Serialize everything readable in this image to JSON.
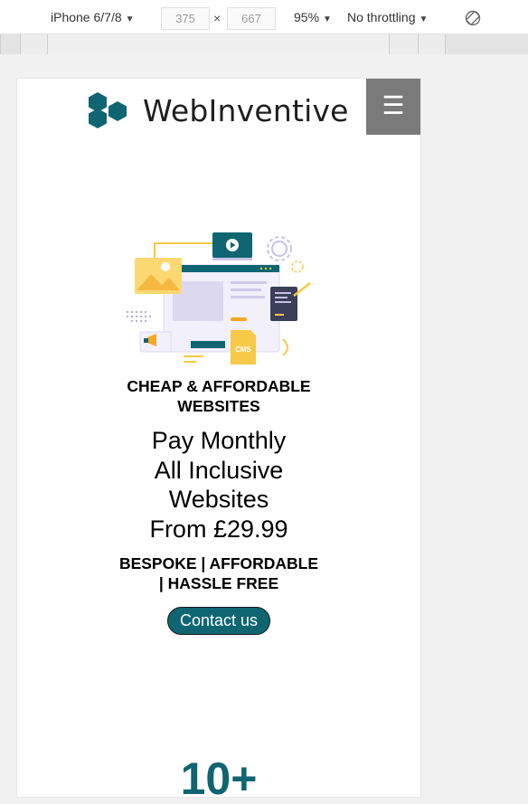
{
  "devtools": {
    "device": "iPhone 6/7/8",
    "width": "375",
    "height": "667",
    "zoom": "95%",
    "throttling": "No throttling",
    "times": "×",
    "caret": "▼"
  },
  "site": {
    "brand": "WebInventive",
    "menu_icon": "☰",
    "hero_subtitle_line1": "CHEAP & AFFORDABLE",
    "hero_subtitle_line2": "WEBSITES",
    "hero_title_line1": "Pay Monthly",
    "hero_title_line2": "All Inclusive",
    "hero_title_line3": "Websites",
    "hero_title_line4": "From £29.99",
    "hero_tags_line1": "BESPOKE | AFFORDABLE",
    "hero_tags_line2": "| HASSLE FREE",
    "contact_label": "Contact us",
    "stat_number": "10+",
    "illustration_badge": "CMS"
  },
  "colors": {
    "brand_teal": "#0f6571",
    "menu_gray": "#7a7a7a",
    "accent_yellow": "#f7c948"
  },
  "icons": [
    "hexagon-logo-icon",
    "hamburger-menu-icon",
    "rotate-icon",
    "play-icon",
    "gear-icon"
  ]
}
